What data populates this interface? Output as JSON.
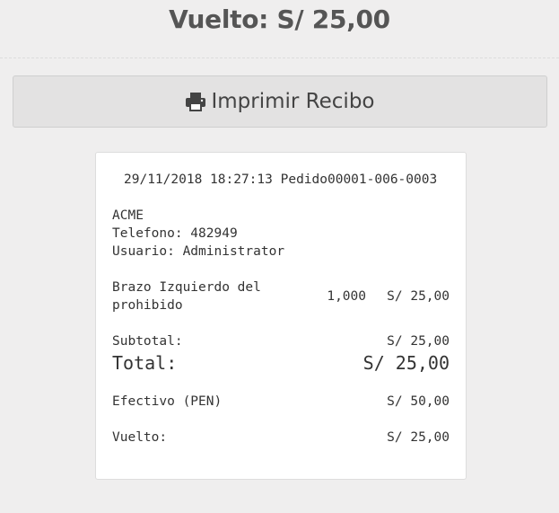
{
  "header": {
    "change_title": "Vuelto: S/ 25,00"
  },
  "print_button": {
    "label": "Imprimir Recibo",
    "icon": "print-icon"
  },
  "receipt": {
    "datetime": "29/11/2018 18:27:13",
    "order_id": "Pedido00001-006-0003",
    "company": "ACME",
    "phone": "Telefono: 482949",
    "user": "Usuario: Administrator",
    "items": [
      {
        "name_line1": "Brazo Izquierdo del",
        "name_line2": "prohibido",
        "qty": "1,000",
        "price": "S/ 25,00"
      }
    ],
    "subtotal_label": "Subtotal:",
    "subtotal_value": "S/ 25,00",
    "total_label": "Total:",
    "total_value": "S/ 25,00",
    "cash_label": "Efectivo (PEN)",
    "cash_value": "S/ 50,00",
    "change_label": "Vuelto:",
    "change_value": "S/ 25,00"
  }
}
